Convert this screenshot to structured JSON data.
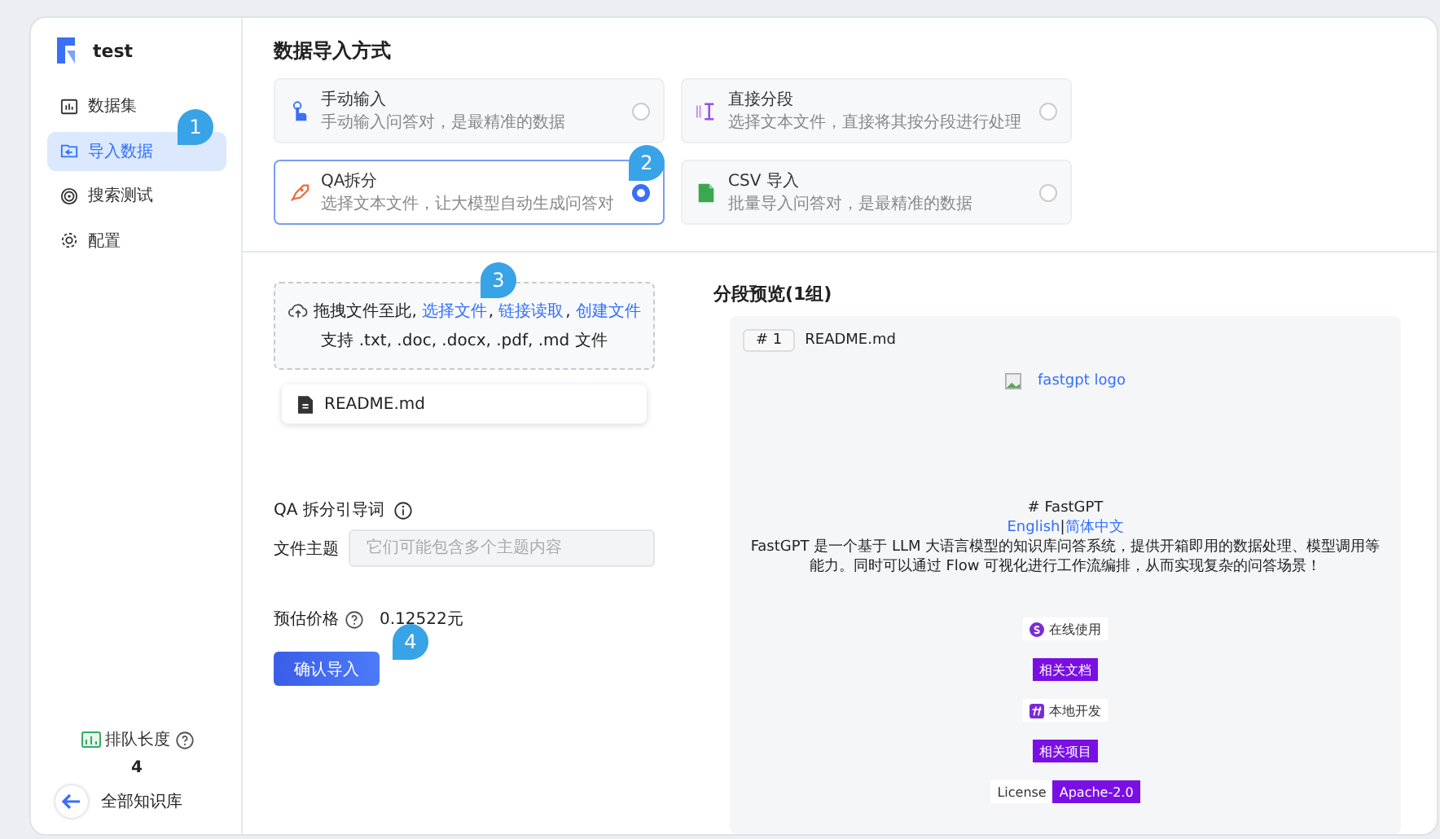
{
  "app": {
    "name": "test"
  },
  "sidebar": {
    "items": [
      {
        "label": "数据集",
        "kind": "dataset",
        "selected": false
      },
      {
        "label": "导入数据",
        "kind": "import",
        "selected": true
      },
      {
        "label": "搜索测试",
        "kind": "search",
        "selected": false
      },
      {
        "label": "配置",
        "kind": "config",
        "selected": false
      }
    ],
    "queue": {
      "label": "排队长度",
      "value": "4"
    },
    "back": {
      "label": "全部知识库"
    }
  },
  "import_methods": {
    "title": "数据导入方式",
    "options": [
      {
        "title": "手动输入",
        "description": "手动输入问答对，是最精准的数据",
        "kind": "manual",
        "selected": false
      },
      {
        "title": "直接分段",
        "description": "选择文本文件，直接将其按分段进行处理",
        "kind": "split",
        "selected": false
      },
      {
        "title": "QA拆分",
        "description": "选择文本文件，让大模型自动生成问答对",
        "kind": "qa",
        "selected": true
      },
      {
        "title": "CSV 导入",
        "description": "批量导入问答对，是最精准的数据",
        "kind": "csv",
        "selected": false
      }
    ]
  },
  "upload": {
    "prompt": "拖拽文件至此,",
    "links": [
      {
        "text": "选择文件",
        "after": ","
      },
      {
        "text": "链接读取",
        "after": ","
      },
      {
        "text": "创建文件"
      }
    ],
    "hint": "支持 .txt, .doc, .docx, .pdf, .md 文件",
    "files": [
      "README.md"
    ]
  },
  "qa_prompt": {
    "label": "QA 拆分引导词",
    "field_label": "文件主题",
    "placeholder": "它们可能包含多个主题内容"
  },
  "price": {
    "label": "预估价格",
    "value": "0.12522元"
  },
  "confirm_button": "确认导入",
  "preview": {
    "title": "分段预览(1组)",
    "chunks": [
      {
        "index": "# 1",
        "source": "README.md",
        "image_alt": "fastgpt logo",
        "heading": "# FastGPT",
        "languages": [
          "English",
          "简体中文"
        ],
        "separator": "|",
        "text": "FastGPT 是一个基于 LLM 大语言模型的知识库问答系统，提供开箱即用的数据处理、模型调用等能力。同时可以通过 Flow 可视化进行工作流编排，从而实现复杂的问答场景！",
        "badges": [
          {
            "kind": "online",
            "text": "在线使用"
          },
          {
            "kind": "purple",
            "text": "相关文档"
          },
          {
            "kind": "local",
            "text": "本地开发"
          },
          {
            "kind": "purple",
            "text": "相关项目"
          },
          {
            "kind": "license",
            "label": "License",
            "text": "Apache-2.0"
          }
        ]
      }
    ]
  },
  "callouts": [
    "1",
    "2",
    "3",
    "4"
  ]
}
